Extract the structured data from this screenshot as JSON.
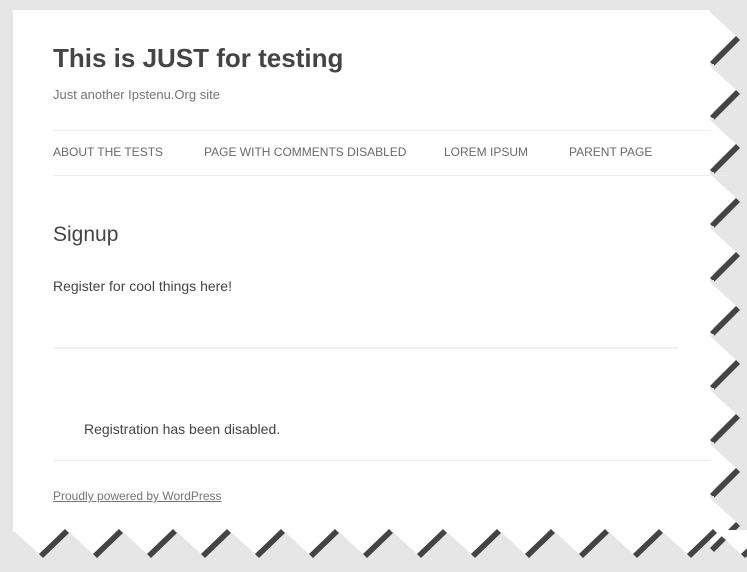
{
  "site": {
    "title": "This is JUST for testing",
    "description": "Just another Ipstenu.Org site"
  },
  "nav": {
    "items": [
      {
        "label": "ABOUT THE TESTS"
      },
      {
        "label": "PAGE WITH COMMENTS DISABLED"
      },
      {
        "label": "LOREM IPSUM"
      },
      {
        "label": "PARENT PAGE"
      }
    ]
  },
  "page": {
    "heading": "Signup",
    "body": "Register for cool things here!"
  },
  "registration": {
    "message": "Registration has been disabled."
  },
  "footer": {
    "powered_by": "Proudly powered by WordPress"
  },
  "colors": {
    "background": "#e6e6e6",
    "sheet": "#ffffff",
    "title": "#444444",
    "muted": "#757575",
    "divider": "#ededed",
    "torn_edge_shadow": "#444444"
  }
}
